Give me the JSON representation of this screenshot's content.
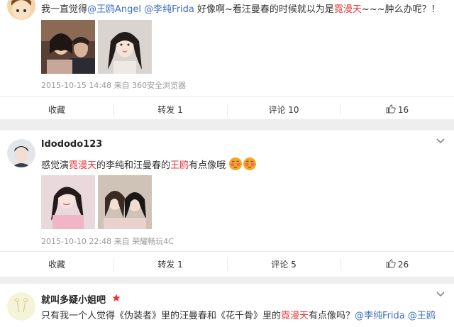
{
  "comments": [
    {
      "text_parts": [
        "我一直觉得",
        "@王鸥Angel",
        " ",
        "@李纯Frida",
        " 好像啊~看汪曼春的时候就以为是",
        "霓漫天",
        "~~~肿么办呢？！"
      ],
      "meta": "2015-10-15 14:48 来自 360安全浏览器",
      "actions": {
        "collect": "收藏",
        "repost": "转发 1",
        "comment": "评论 10",
        "like": "16"
      }
    },
    {
      "username": "ldododo123",
      "text_parts": [
        "感觉演",
        "霓漫天",
        "的李纯和汪曼春的",
        "王鸥",
        "有点像哦"
      ],
      "meta": "2015-10-10 22:48 来自 荣耀畅玩4C",
      "actions": {
        "collect": "收藏",
        "repost": "转发 1",
        "comment": "评论 5",
        "like": "26"
      }
    },
    {
      "username": "就叫多疑小姐吧",
      "text_parts": [
        "只有我一个人觉得《伪装者》里的汪曼春和《花千骨》里的",
        "霓漫天",
        "有点像吗？",
        "@李纯Frida",
        " ",
        "@王鸥"
      ]
    }
  ],
  "colors": {
    "mention": "#3d6fc4",
    "highlight": "#e4393c",
    "meta": "#999999",
    "star": "#e4393c",
    "emoji": "#f5a623"
  },
  "icons": [
    "like-icon",
    "chevron-down-icon",
    "vip-star-icon",
    "shy-emoji-icon"
  ]
}
